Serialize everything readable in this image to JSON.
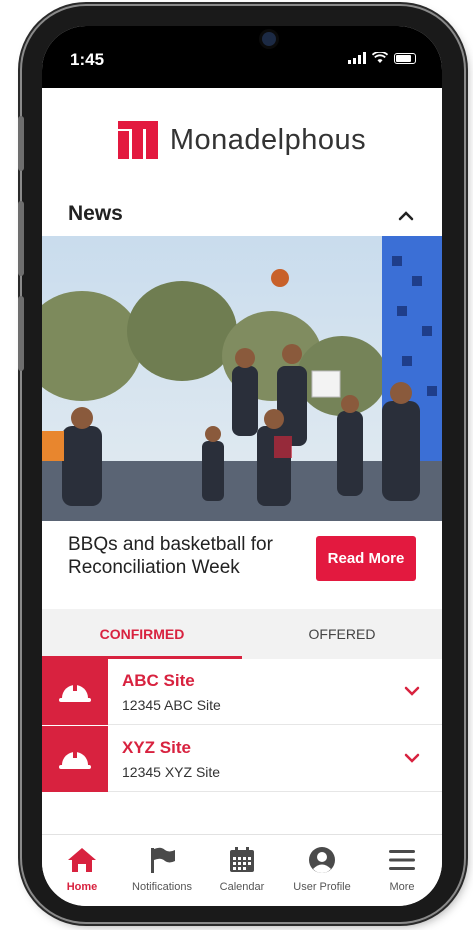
{
  "status_bar": {
    "time": "1:45"
  },
  "brand": {
    "name": "Monadelphous",
    "accent": "#d8223f"
  },
  "news": {
    "section_title": "News",
    "headline": "BBQs and basketball for Reconciliation Week",
    "read_more_label": "Read More"
  },
  "tabs": [
    {
      "label": "CONFIRMED",
      "active": true
    },
    {
      "label": "OFFERED",
      "active": false
    }
  ],
  "sites": [
    {
      "name": "ABC Site",
      "subtitle": "12345  ABC Site",
      "icon": "hard-hat-icon"
    },
    {
      "name": "XYZ Site",
      "subtitle": "12345  XYZ Site",
      "icon": "hard-hat-icon"
    }
  ],
  "bottom_nav": [
    {
      "label": "Home",
      "icon": "home-icon",
      "active": true
    },
    {
      "label": "Notifications",
      "icon": "flag-icon",
      "active": false
    },
    {
      "label": "Calendar",
      "icon": "calendar-icon",
      "active": false
    },
    {
      "label": "User Profile",
      "icon": "user-icon",
      "active": false
    },
    {
      "label": "More",
      "icon": "menu-icon",
      "active": false
    }
  ]
}
